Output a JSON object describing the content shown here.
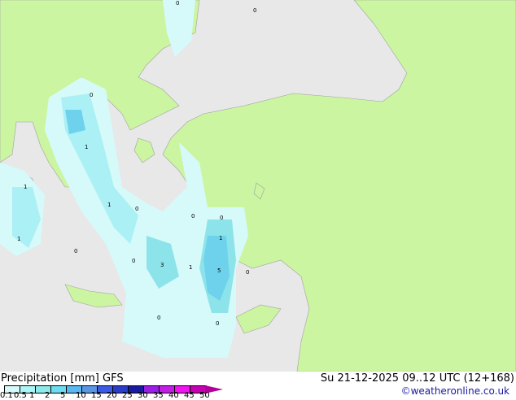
{
  "title": "Precipitation [mm]  GFS",
  "valid_time": "Su 21-12-2025 09..12 UTC (12+168)",
  "credit": "©weatheronline.co.uk",
  "legend": {
    "ticks": [
      "0.1",
      "0.5",
      "1",
      "2",
      "5",
      "10",
      "15",
      "20",
      "25",
      "30",
      "35",
      "40",
      "45",
      "50"
    ],
    "colors": [
      "#d6fafa",
      "#aaf5f5",
      "#8ceaea",
      "#6edcf0",
      "#5ab8f0",
      "#5a96e6",
      "#3c5ae6",
      "#2a3cc8",
      "#1a1aa0",
      "#9a1ee6",
      "#c31ee6",
      "#f014f0",
      "#c800b4"
    ]
  },
  "map_labels": [
    "0",
    "0",
    "0",
    "1",
    "1",
    "1",
    "0",
    "0",
    "1",
    "0",
    "0",
    "3",
    "1",
    "5",
    "0",
    "0",
    "0",
    "1",
    "0"
  ],
  "colors": {
    "land": "#ccf5a2",
    "sea": "#e8e8e8",
    "precip_light": "#d6fafa",
    "precip_mid": "#aaf0f5",
    "precip_high": "#6ed2ec"
  }
}
